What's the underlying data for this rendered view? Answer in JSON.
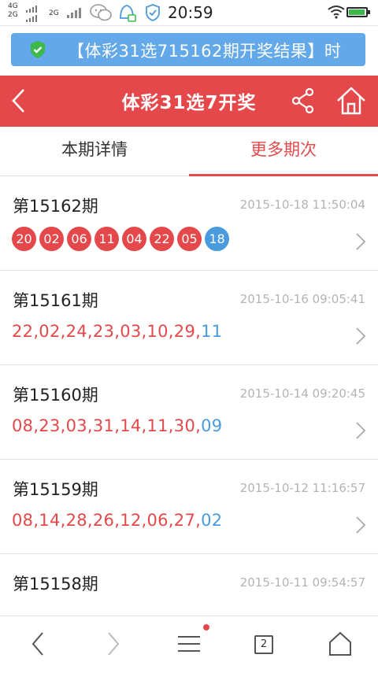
{
  "status_bar": {
    "sim1": "4G",
    "sim2": "2G",
    "sim3": "2G",
    "time": "20:59",
    "battery_level": 0.95,
    "colors": {
      "battery": "#3db84a"
    }
  },
  "banner": {
    "text": "【体彩31选715162期开奖结果】时",
    "color": "#63a8e8"
  },
  "header": {
    "title": "体彩31选7开奖",
    "color": "#e5484a"
  },
  "tabs": [
    {
      "label": "本期详情",
      "active": false
    },
    {
      "label": "更多期次",
      "active": true
    }
  ],
  "draws": [
    {
      "period": "第15162期",
      "time": "2015-10-18 11:50:04",
      "red": [
        "20",
        "02",
        "06",
        "11",
        "04",
        "22",
        "05"
      ],
      "blue": "18",
      "style": "balls"
    },
    {
      "period": "第15161期",
      "time": "2015-10-16 09:05:41",
      "red_text": "22,02,24,23,03,10,29,",
      "blue": "11",
      "style": "text"
    },
    {
      "period": "第15160期",
      "time": "2015-10-14 09:20:45",
      "red_text": "08,23,03,31,14,11,30,",
      "blue": "09",
      "style": "text"
    },
    {
      "period": "第15159期",
      "time": "2015-10-12 11:16:57",
      "red_text": "08,14,28,26,12,06,27,",
      "blue": "02",
      "style": "text"
    },
    {
      "period": "第15158期",
      "time": "2015-10-11 09:54:57"
    }
  ],
  "bottom_nav": {
    "tab_count": "2",
    "icons": [
      "back-icon",
      "forward-icon",
      "menu-icon",
      "tabs-icon",
      "home-icon"
    ]
  }
}
